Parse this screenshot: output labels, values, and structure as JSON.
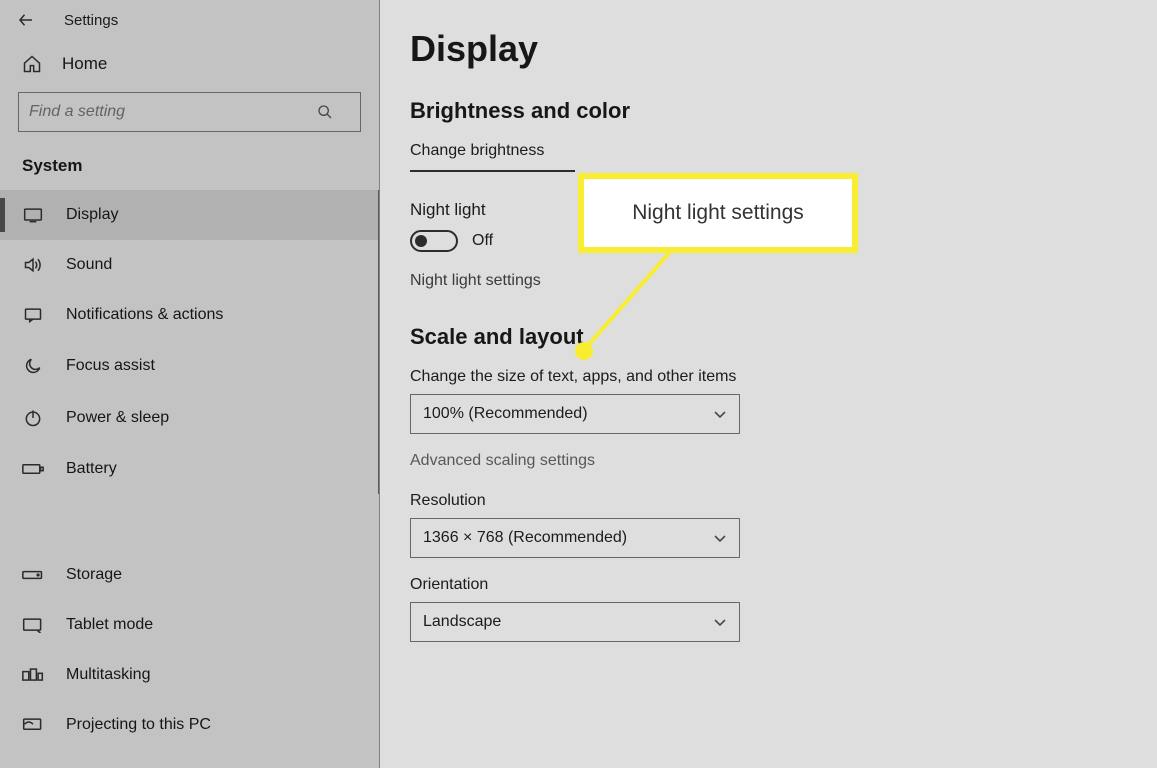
{
  "header": {
    "title": "Settings"
  },
  "home_label": "Home",
  "search": {
    "placeholder": "Find a setting"
  },
  "category_label": "System",
  "nav": {
    "items": [
      {
        "label": "Display"
      },
      {
        "label": "Sound"
      },
      {
        "label": "Notifications & actions"
      },
      {
        "label": "Focus assist"
      },
      {
        "label": "Power & sleep"
      },
      {
        "label": "Battery"
      },
      {
        "label": "Storage"
      },
      {
        "label": "Tablet mode"
      },
      {
        "label": "Multitasking"
      },
      {
        "label": "Projecting to this PC"
      }
    ]
  },
  "main": {
    "title": "Display",
    "section_brightness": "Brightness and color",
    "change_brightness": "Change brightness",
    "night_light_label": "Night light",
    "night_light_state": "Off",
    "night_light_settings": "Night light settings",
    "section_scale": "Scale and layout",
    "scale_text_label": "Change the size of text, apps, and other items",
    "scale_value": "100% (Recommended)",
    "advanced_scaling": "Advanced scaling settings",
    "resolution_label": "Resolution",
    "resolution_value": "1366 × 768 (Recommended)",
    "orientation_label": "Orientation",
    "orientation_value": "Landscape"
  },
  "callout": {
    "text": "Night light settings"
  }
}
